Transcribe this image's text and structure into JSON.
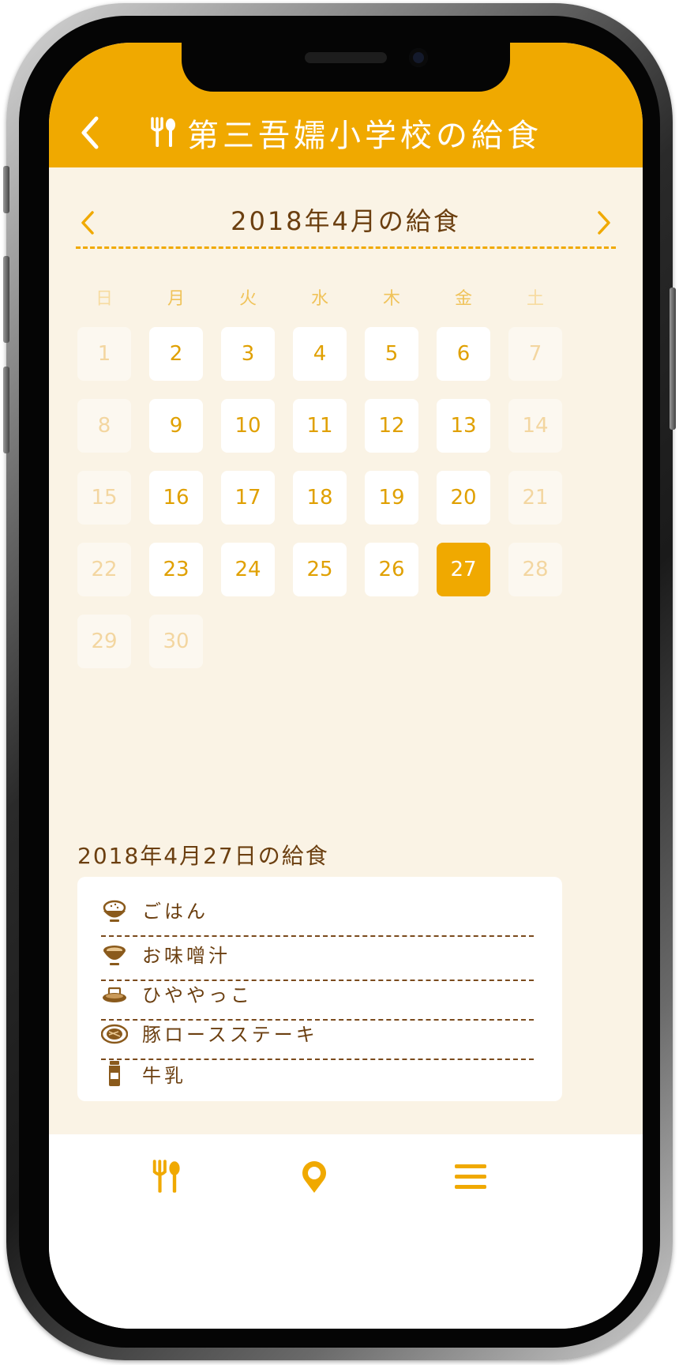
{
  "header": {
    "back_label": "‹",
    "title": "第三吾嬬小学校の給食"
  },
  "calendar": {
    "month_title": "2018年4月の給食",
    "prev_label": "<",
    "next_label": ">",
    "weekdays": [
      "日",
      "月",
      "火",
      "水",
      "木",
      "金",
      "土"
    ],
    "selected_day": "27",
    "days": [
      "1",
      "2",
      "3",
      "4",
      "5",
      "6",
      "7",
      "8",
      "9",
      "10",
      "11",
      "12",
      "13",
      "14",
      "15",
      "16",
      "17",
      "18",
      "19",
      "20",
      "21",
      "22",
      "23",
      "24",
      "25",
      "26",
      "27",
      "28",
      "29",
      "30"
    ]
  },
  "menu": {
    "title": "2018年4月27日の給食",
    "items": [
      {
        "label": "ごはん",
        "icon": "rice-bowl-icon"
      },
      {
        "label": "お味噌汁",
        "icon": "soup-bowl-icon"
      },
      {
        "label": "ひややっこ",
        "icon": "tofu-plate-icon"
      },
      {
        "label": "豚ロースステーキ",
        "icon": "steak-plate-icon"
      },
      {
        "label": "牛乳",
        "icon": "milk-bottle-icon"
      }
    ]
  },
  "tabbar": {
    "items": [
      {
        "icon": "fork-spoon-icon"
      },
      {
        "icon": "location-pin-icon"
      },
      {
        "icon": "hamburger-menu-icon"
      }
    ]
  },
  "colors": {
    "accent": "#f0a900",
    "background": "#faf3e5",
    "text_brown": "#6b3f10"
  }
}
